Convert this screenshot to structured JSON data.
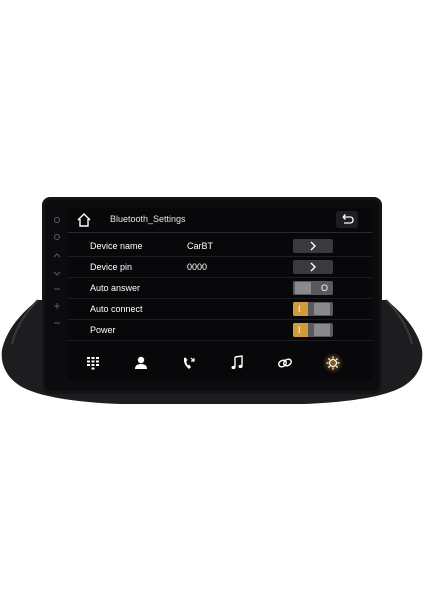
{
  "header": {
    "title": "Bluetooth_Settings",
    "home_icon": "home-icon",
    "back_icon": "back-arrow-icon"
  },
  "settings": {
    "device_name": {
      "label": "Device name",
      "value": "CarBT"
    },
    "device_pin": {
      "label": "Device pin",
      "value": "0000"
    },
    "auto_answer": {
      "label": "Auto answer",
      "state": "off"
    },
    "auto_connect": {
      "label": "Auto connect",
      "state": "on"
    },
    "power": {
      "label": "Power",
      "state": "on"
    }
  },
  "toggle_marks": {
    "on": "I",
    "off": "O"
  },
  "dock": {
    "items": [
      "dialpad-icon",
      "contacts-icon",
      "call-log-icon",
      "music-icon",
      "link-icon",
      "settings-gear-icon"
    ],
    "active": "settings-gear-icon"
  },
  "colors": {
    "accent": "#d39a3c",
    "screen_bg": "#08080a",
    "bezel": "#161618"
  }
}
